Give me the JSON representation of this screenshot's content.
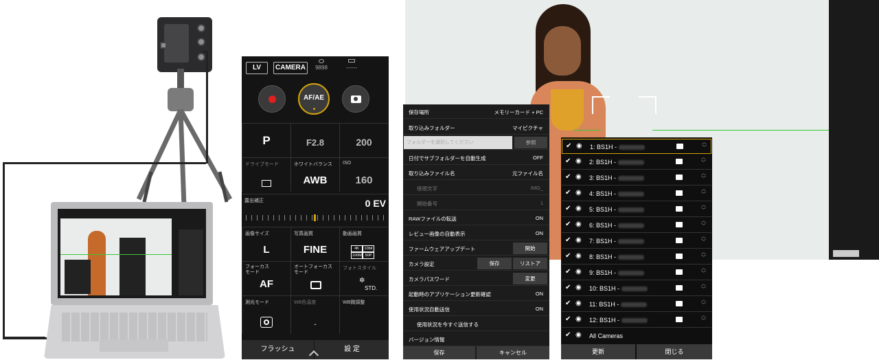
{
  "panel": {
    "lv_label": "LV",
    "camera_label": "CAMERA",
    "shots_remaining": "9898",
    "battery_text": "------",
    "record_icon": "record-icon",
    "af_ae_label": "AF/AE",
    "shutter_icon": "camera-icon",
    "mode": "P",
    "aperture": "F2.8",
    "iso_value": "200",
    "drive_mode_label": "ドライブモード",
    "white_balance_label": "ホワイトバランス",
    "iso_label": "ISO",
    "white_balance_value": "AWB",
    "iso_value_2": "160",
    "exposure_comp_label": "露出補正",
    "exposure_comp_value": "0 EV",
    "image_size_label": "画像サイズ",
    "photo_quality_label": "写真画質",
    "video_quality_label": "動画画質",
    "image_size_value": "L",
    "photo_quality_value": "FINE",
    "video_quality_badges": [
      "4K",
      "10bit",
      "100M",
      "50P"
    ],
    "focus_mode_label": "フォーカス\nモード",
    "af_mode_label": "オートフォーカス\nモード",
    "photo_style_label": "フォトスタイル",
    "focus_mode_value": "AF",
    "photo_style_value": "STD.",
    "metering_label": "測光モード",
    "wb_temp_label": "WB色温度",
    "wb_fine_label": "WB微調整",
    "wb_temp_value": "-",
    "footer_flash": "フラッシュ",
    "footer_settings": "設 定"
  },
  "menu": {
    "rows": [
      {
        "key": "保存場所",
        "value": "メモリーカード + PC"
      },
      {
        "key": "取り込みフォルダー",
        "value": "マイピクチャ"
      },
      {
        "key": "フォルダーを選択してください",
        "value": "参照"
      },
      {
        "key": "日付でサブフォルダーを自動生成",
        "value": "OFF"
      },
      {
        "key": "取り込みファイル名",
        "value": "元ファイル名"
      },
      {
        "key": "接頭文字",
        "value": "IMG_"
      },
      {
        "key": "開始番号",
        "value": "1"
      },
      {
        "key": "RAWファイルの転送",
        "value": "ON"
      },
      {
        "key": "レビュー画像の自動表示",
        "value": "ON"
      },
      {
        "key": "ファームウェアアップデート",
        "value": "開始"
      },
      {
        "key": "カメラ設定",
        "value": "保存",
        "value2": "リストア"
      },
      {
        "key": "カメラパスワード",
        "value": "変更"
      },
      {
        "key": "起動時のアプリケーション更新確認",
        "value": "ON"
      },
      {
        "key": "使用状況自動送信",
        "value": "ON"
      },
      {
        "key": "使用状況を今すぐ送信する",
        "value": ""
      },
      {
        "key": "バージョン情報",
        "value": ""
      }
    ],
    "save_label": "保存",
    "cancel_label": "キャンセル"
  },
  "camera_list": {
    "rows": [
      {
        "label": "1:  BS1H -"
      },
      {
        "label": "2:  BS1H -"
      },
      {
        "label": "3:  BS1H -"
      },
      {
        "label": "4:  BS1H -"
      },
      {
        "label": "5:  BS1H -"
      },
      {
        "label": "6:  BS1H -"
      },
      {
        "label": "7:  BS1H -"
      },
      {
        "label": "8:  BS1H -"
      },
      {
        "label": "9:  BS1H -"
      },
      {
        "label": "10: BS1H -"
      },
      {
        "label": "11: BS1H -"
      },
      {
        "label": "12: BS1H -"
      }
    ],
    "all_cameras": "All Cameras",
    "refresh_label": "更新",
    "close_label": "閉じる"
  },
  "colors": {
    "accent": "#d4a30a",
    "record": "#e0201e",
    "guide_line": "#37c837"
  }
}
